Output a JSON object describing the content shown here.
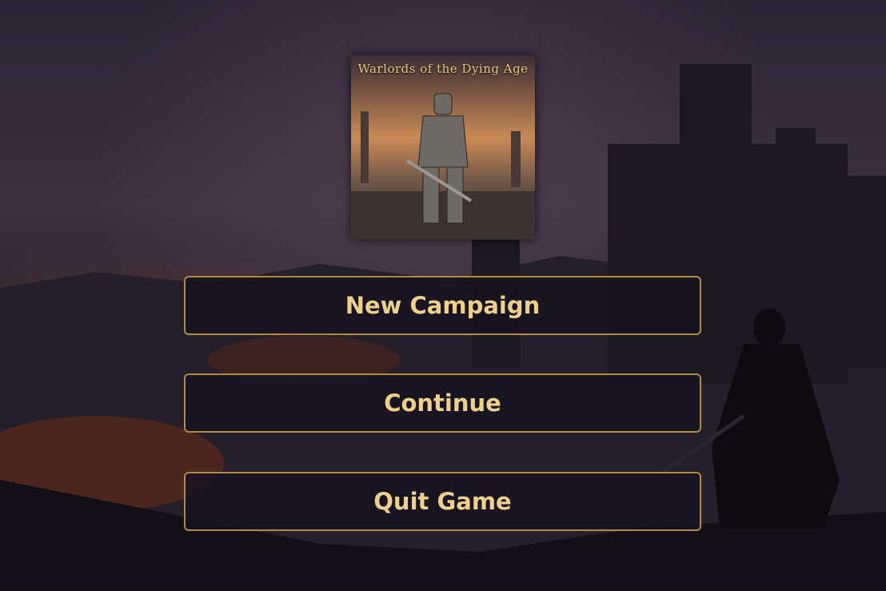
{
  "logo": {
    "title": "Warlords of the Dying Age"
  },
  "menu": {
    "new_campaign": "New Campaign",
    "continue": "Continue",
    "quit": "Quit Game"
  },
  "colors": {
    "accent": "#b08b3c",
    "text": "#edd08a",
    "button_bg": "#16131f"
  }
}
